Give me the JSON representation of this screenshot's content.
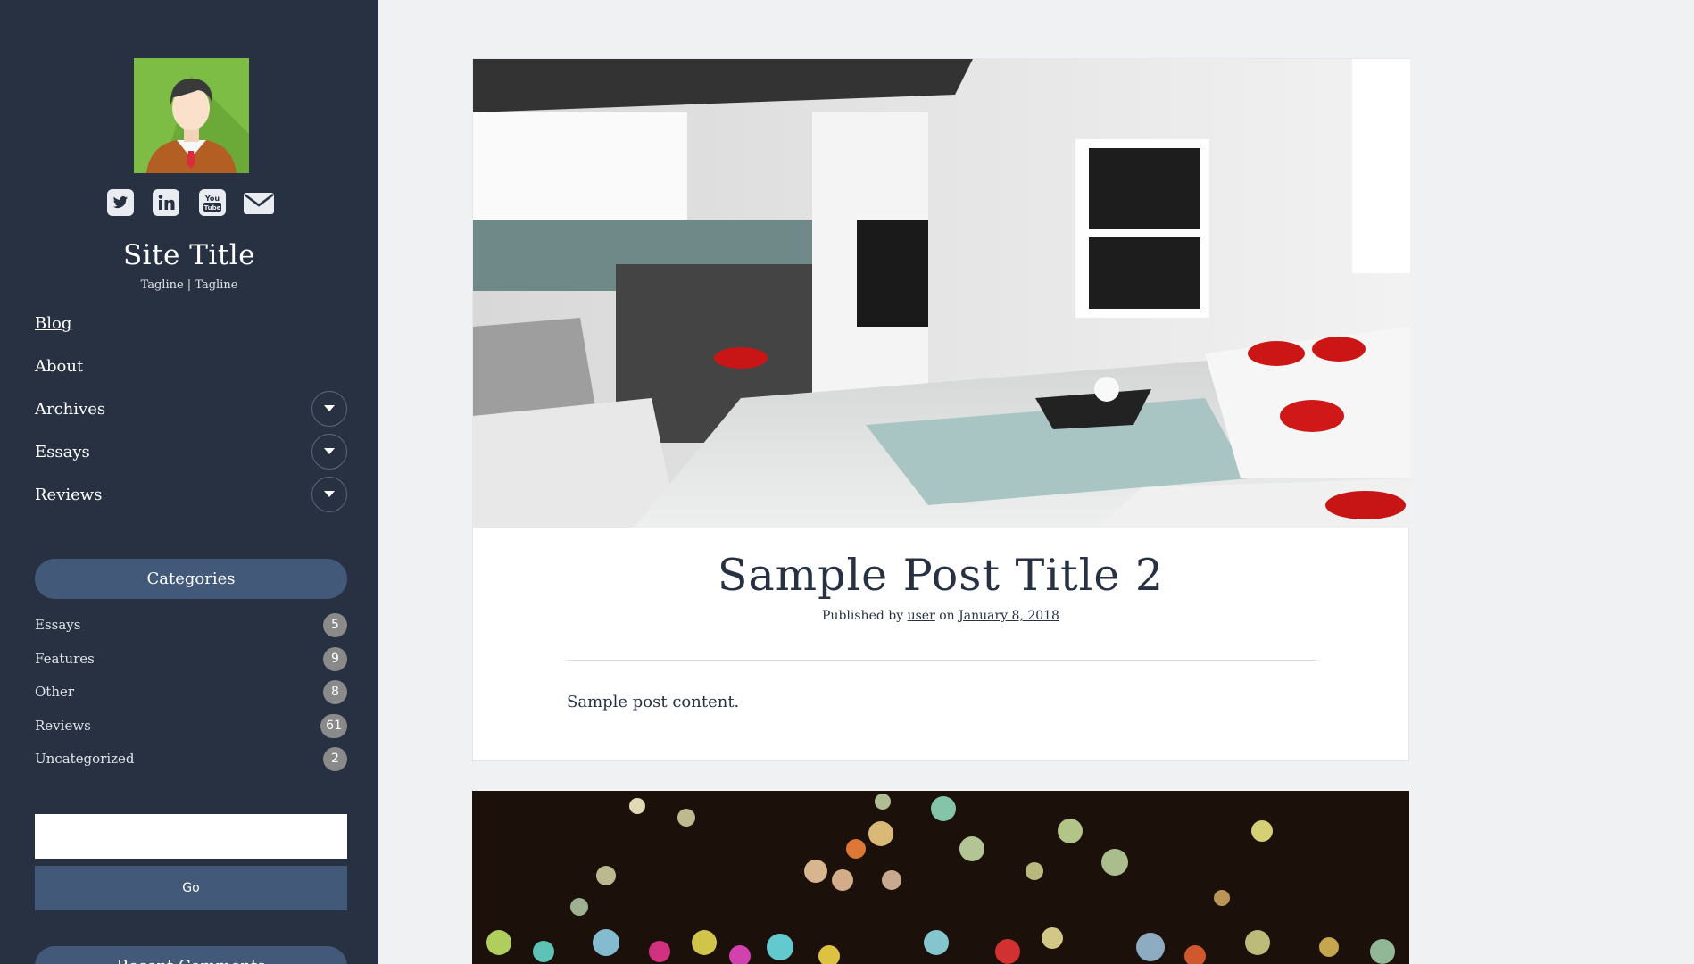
{
  "sidebar": {
    "avatar_alt": "avatar",
    "social": [
      {
        "icon": "twitter-icon"
      },
      {
        "icon": "linkedin-icon"
      },
      {
        "icon": "youtube-icon"
      },
      {
        "icon": "email-icon"
      }
    ],
    "site_title": "Site Title",
    "tagline": "Tagline | Tagline",
    "nav": [
      {
        "label": "Blog",
        "active": true
      },
      {
        "label": "About"
      },
      {
        "label": "Archives",
        "has_submenu": true
      },
      {
        "label": "Essays",
        "has_submenu": true
      },
      {
        "label": "Reviews",
        "has_submenu": true
      }
    ],
    "categories_title": "Categories",
    "categories": [
      {
        "name": "Essays",
        "count": "5"
      },
      {
        "name": "Features",
        "count": "9"
      },
      {
        "name": "Other",
        "count": "8"
      },
      {
        "name": "Reviews",
        "count": "61"
      },
      {
        "name": "Uncategorized",
        "count": "2"
      }
    ],
    "search": {
      "value": "",
      "button": "Go"
    },
    "recent_comments_title": "Recent Comments"
  },
  "post": {
    "title": "Sample Post Title 2",
    "meta": {
      "prefix": "Published by",
      "author": "user",
      "on": "on",
      "date": "January 8, 2018"
    },
    "content": "Sample post content."
  },
  "colors": {
    "sidebar_bg": "#273142",
    "accent": "#43597a",
    "page_bg": "#eff1f3",
    "badge": "#8a8a8a"
  }
}
